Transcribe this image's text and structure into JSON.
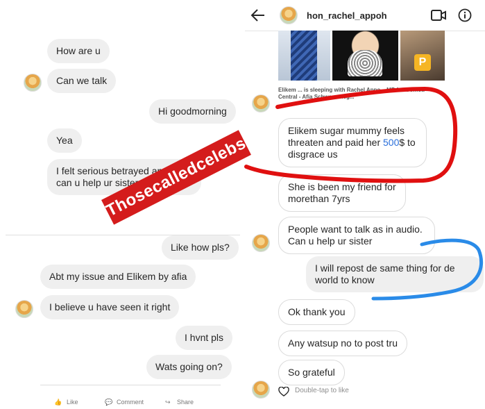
{
  "left_top": {
    "messages": [
      "How are u",
      "Can we talk",
      "Hi goodmorning",
      "Yea",
      "I felt serious betrayed and how can u help ur sister"
    ]
  },
  "left_bottom": {
    "messages": [
      "Like how pls?",
      "Abt my issue and Elikem by afia",
      "I believe u have seen it right",
      "I hvnt pls",
      "Wats going on?"
    ],
    "actions": {
      "like": "Like",
      "comment": "Comment",
      "share": "Share"
    }
  },
  "right": {
    "header": {
      "username": "hon_rachel_appoh"
    },
    "post": {
      "caption": "Elikem ... is sleeping with Rachel Appo... MP for Gomoa Central - Afia Schwarzeneg..."
    },
    "messages": [
      "Elikem sugar mummy feels threaten and paid her 500$ to disgrace us",
      "She is been my friend for morethan 7yrs",
      "People want to talk as in audio. Can u help ur sister",
      "I will repost de same thing for de world to know",
      "Ok thank you",
      "Any watsup no to post tru",
      "So grateful"
    ],
    "double_tap": "Double-tap to like"
  },
  "watermark": "Thosecalledcelebs",
  "colors": {
    "annotation_red": "#e01010",
    "annotation_blue": "#2a8be8",
    "watermark_bg": "#d41c1c",
    "bubble_bg": "#efefef"
  }
}
